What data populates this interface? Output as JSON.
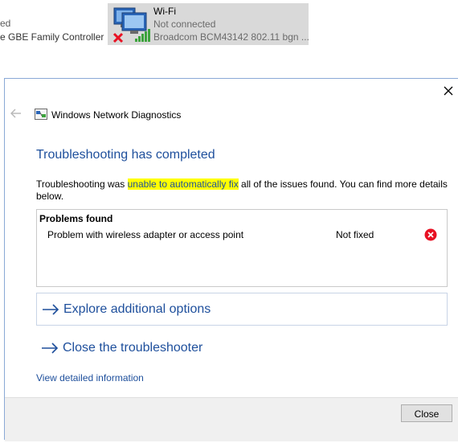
{
  "background_window": {
    "ethernet_status_partial": "ed",
    "ethernet_device_partial": "e GBE Family Controller",
    "wifi": {
      "name": "Wi-Fi",
      "status": "Not connected",
      "device": "Broadcom BCM43142 802.11 bgn ..."
    }
  },
  "dialog": {
    "app_title": "Windows Network Diagnostics",
    "heading": "Troubleshooting has completed",
    "description": {
      "before": "Troubleshooting was ",
      "highlight": "unable to automatically fix",
      "after": " all of the issues found. You can find more details below."
    },
    "problems": {
      "header": "Problems found",
      "items": [
        {
          "name": "Problem with wireless adapter or access point",
          "status": "Not fixed",
          "status_icon": "error-icon"
        }
      ]
    },
    "options": {
      "explore": "Explore additional options",
      "close_troubleshooter": "Close the troubleshooter"
    },
    "detail_link": "View detailed information",
    "close_button": "Close"
  },
  "colors": {
    "accent_link": "#1e4f9c",
    "highlight": "#ffff00",
    "error": "#e81123"
  }
}
